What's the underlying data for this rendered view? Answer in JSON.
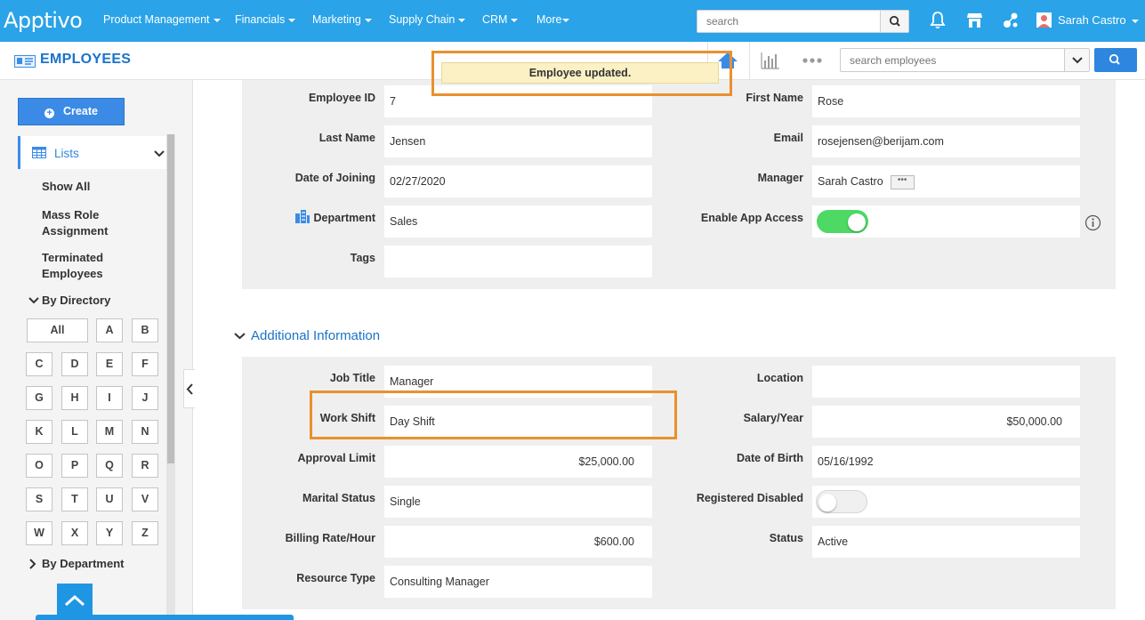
{
  "brand": {
    "logo": "Apptivo"
  },
  "nav": {
    "items": [
      "Product Management",
      "Financials",
      "Marketing",
      "Supply Chain",
      "CRM",
      "More"
    ],
    "search_placeholder": "search",
    "user_name": "Sarah Castro"
  },
  "subheader": {
    "title": "EMPLOYEES",
    "search_placeholder": "search employees"
  },
  "toast": {
    "message": "Employee updated."
  },
  "sidebar": {
    "create_label": "Create",
    "lists_label": "Lists",
    "links": [
      "Show All",
      "Mass Role Assignment",
      "Terminated Employees"
    ],
    "by_directory": "By Directory",
    "letters": [
      "All",
      "A",
      "B",
      "C",
      "D",
      "E",
      "F",
      "G",
      "H",
      "I",
      "J",
      "K",
      "L",
      "M",
      "N",
      "O",
      "P",
      "Q",
      "R",
      "S",
      "T",
      "U",
      "V",
      "W",
      "X",
      "Y",
      "Z"
    ],
    "by_department": "By Department"
  },
  "basic": {
    "employee_id": {
      "label": "Employee ID",
      "value": "7"
    },
    "first_name": {
      "label": "First Name",
      "value": "Rose"
    },
    "last_name": {
      "label": "Last Name",
      "value": "Jensen"
    },
    "email": {
      "label": "Email",
      "value": "rosejensen@berijam.com"
    },
    "date_of_joining": {
      "label": "Date of Joining",
      "value": "02/27/2020"
    },
    "manager": {
      "label": "Manager",
      "value": "Sarah Castro"
    },
    "department": {
      "label": "Department",
      "value": "Sales"
    },
    "enable_app_access": {
      "label": "Enable App Access",
      "on": true
    },
    "tags": {
      "label": "Tags",
      "value": ""
    }
  },
  "additional": {
    "title": "Additional Information",
    "job_title": {
      "label": "Job Title",
      "value": "Manager"
    },
    "location": {
      "label": "Location",
      "value": ""
    },
    "work_shift": {
      "label": "Work Shift",
      "value": "Day Shift"
    },
    "salary_year": {
      "label": "Salary/Year",
      "value": "$50,000.00"
    },
    "approval_limit": {
      "label": "Approval Limit",
      "value": "$25,000.00"
    },
    "date_of_birth": {
      "label": "Date of Birth",
      "value": "05/16/1992"
    },
    "marital_status": {
      "label": "Marital Status",
      "value": "Single"
    },
    "registered_disabled": {
      "label": "Registered Disabled",
      "on": false
    },
    "billing_rate_hour": {
      "label": "Billing Rate/Hour",
      "value": "$600.00"
    },
    "status": {
      "label": "Status",
      "value": "Active"
    },
    "resource_type": {
      "label": "Resource Type",
      "value": "Consulting Manager"
    }
  },
  "colors": {
    "brand": "#2aa3e8",
    "accent": "#2e86de",
    "toggle_on": "#4cd964",
    "highlight": "#e8912e",
    "toast_bg": "#fbf1c4"
  }
}
